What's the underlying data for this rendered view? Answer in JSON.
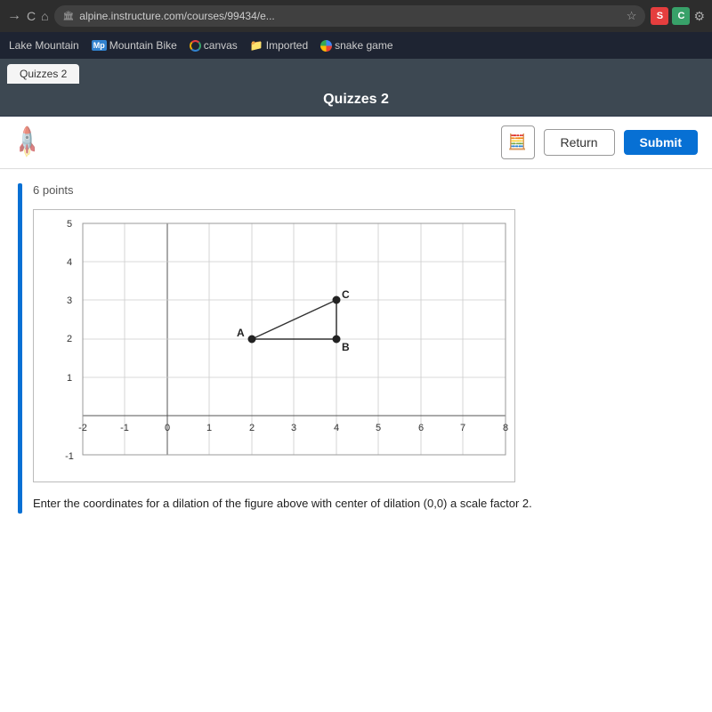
{
  "browser": {
    "tab_label": "Quizzes 2",
    "address": "alpine.instructure.com/courses/99434/e...",
    "icons": {
      "s": "S",
      "c": "C"
    }
  },
  "bookmarks": {
    "items": [
      {
        "label": "Lake Mountain",
        "icon_type": "text",
        "icon_text": ""
      },
      {
        "label": "Mountain Bike",
        "icon_type": "mp",
        "icon_text": "Mp"
      },
      {
        "label": "canvas",
        "icon_type": "canvas"
      },
      {
        "label": "Imported",
        "icon_type": "folder"
      },
      {
        "label": "snake game",
        "icon_type": "google"
      }
    ]
  },
  "page": {
    "title": "Quizzes 2"
  },
  "toolbar": {
    "return_label": "Return",
    "submit_label": "Submit"
  },
  "question": {
    "points": "6 points",
    "text": "Enter the coordinates for a dilation of the figure above with center of dilation (0,0) a scale factor 2.",
    "graph": {
      "x_min": -2,
      "x_max": 8,
      "y_min": -1,
      "y_max": 5,
      "points": {
        "A": {
          "x": 2,
          "y": 2,
          "label": "A"
        },
        "B": {
          "x": 4,
          "y": 2,
          "label": "B"
        },
        "C": {
          "x": 4,
          "y": 3,
          "label": "C"
        }
      }
    }
  }
}
